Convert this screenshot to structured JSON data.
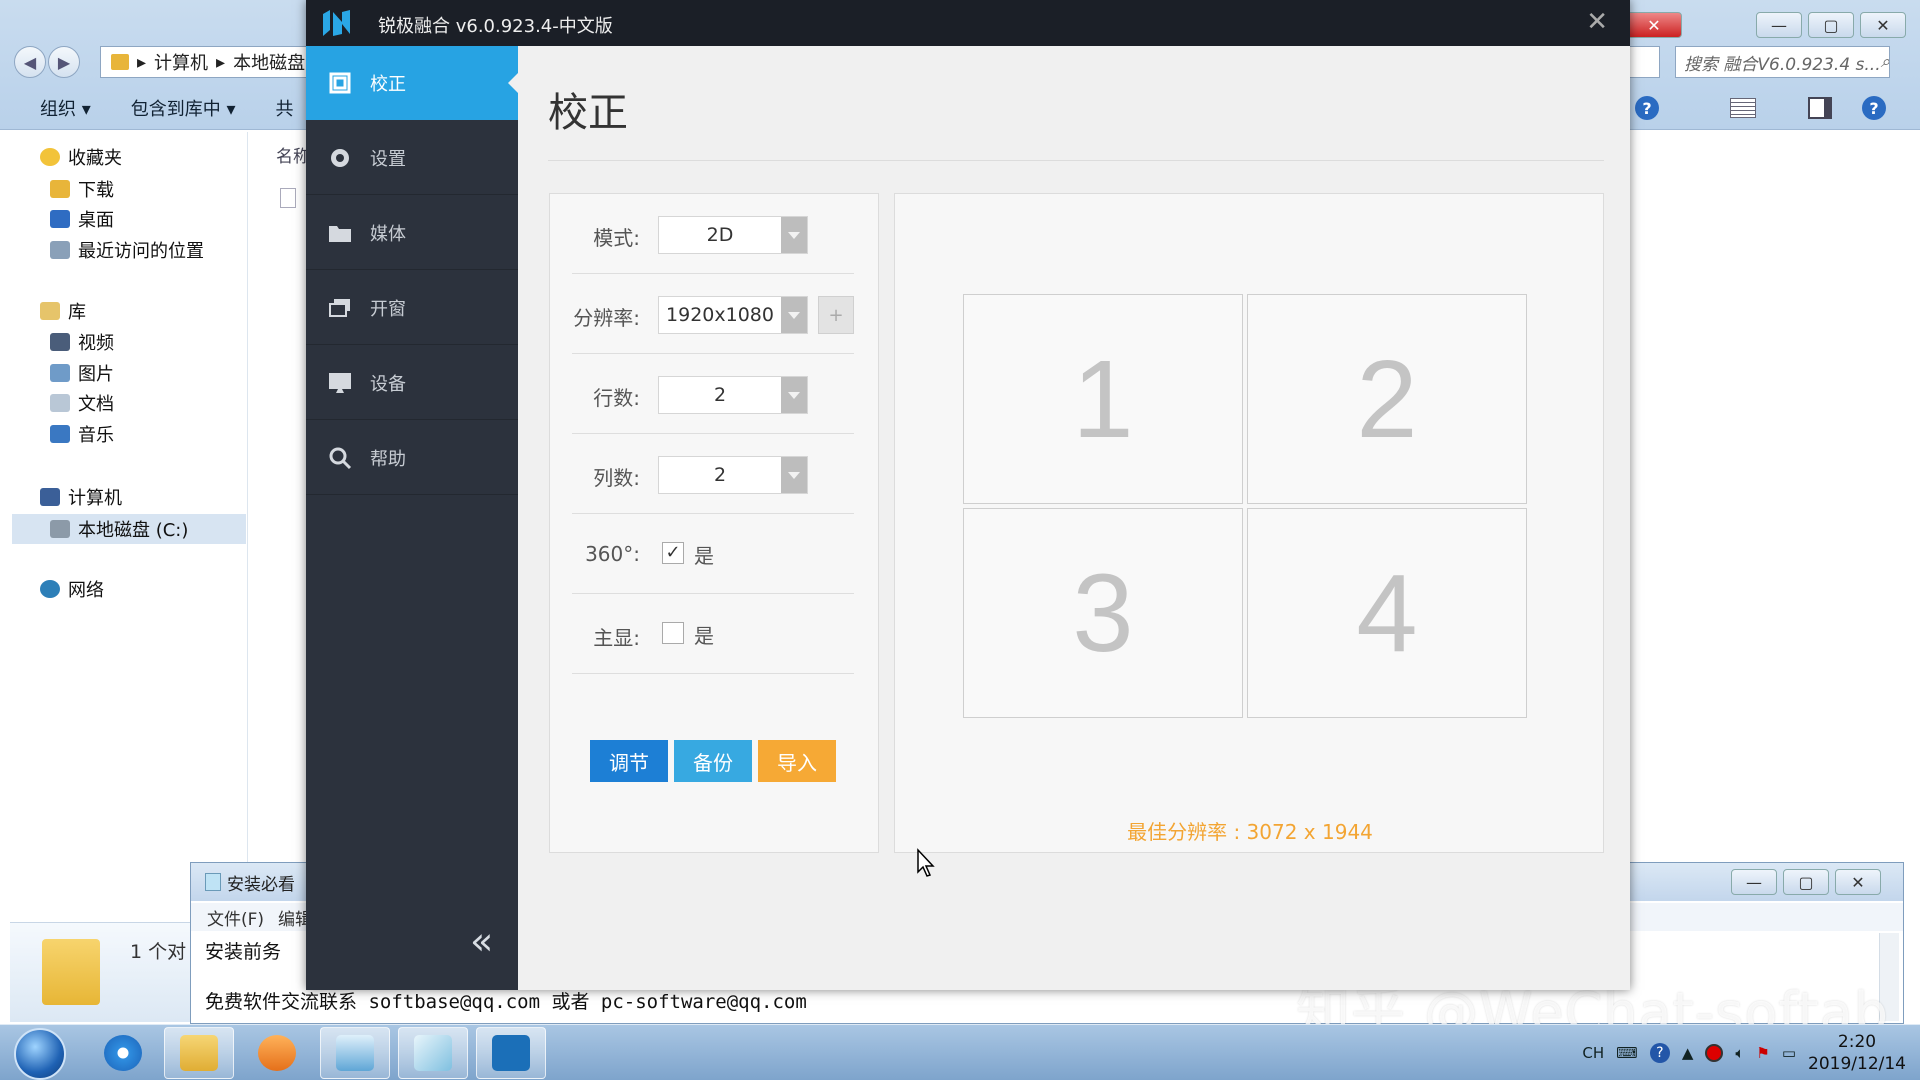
{
  "explorer": {
    "breadcrumb": [
      "计算机",
      "本地磁盘"
    ],
    "search_placeholder": "搜索 融合V6.0.923.4 s...",
    "toolbar": [
      "组织 ▾",
      "包含到库中 ▾",
      "共"
    ],
    "column_header": "名称",
    "nav": {
      "favorites": "收藏夹",
      "downloads": "下载",
      "desktop": "桌面",
      "recent": "最近访问的位置",
      "libraries": "库",
      "videos": "视频",
      "pictures": "图片",
      "documents": "文档",
      "music": "音乐",
      "computer": "计算机",
      "local_disk": "本地磁盘 (C:)",
      "network": "网络"
    },
    "status_count": "1 个对"
  },
  "notepad": {
    "title": "安装必看",
    "menu": [
      "文件(F)",
      "编辑"
    ],
    "line1": "安装前务",
    "line2": "免费软件交流联系 softbase@qq.com 或者 pc-software@qq.com"
  },
  "watermark": "知乎 @WeChat-softab",
  "app": {
    "title": "锐极融合 v6.0.923.4-中文版",
    "sidebar": [
      {
        "label": "校正",
        "icon": "calibrate-icon"
      },
      {
        "label": "设置",
        "icon": "gear-icon"
      },
      {
        "label": "媒体",
        "icon": "folder-icon"
      },
      {
        "label": "开窗",
        "icon": "windows-icon"
      },
      {
        "label": "设备",
        "icon": "monitor-icon"
      },
      {
        "label": "帮助",
        "icon": "search-icon"
      }
    ],
    "page_title": "校正",
    "form": {
      "mode_label": "模式:",
      "mode_value": "2D",
      "resolution_label": "分辨率:",
      "resolution_value": "1920x1080",
      "plus": "+",
      "rows_label": "行数:",
      "rows_value": "2",
      "cols_label": "列数:",
      "cols_value": "2",
      "r360_label": "360°:",
      "r360_checked": true,
      "r360_option": "是",
      "primary_label": "主显:",
      "primary_checked": false,
      "primary_option": "是"
    },
    "buttons": {
      "adjust": "调节",
      "backup": "备份",
      "import": "导入"
    },
    "grid_cells": [
      "1",
      "2",
      "3",
      "4"
    ],
    "best_resolution": "最佳分辨率 : 3072 x 1944",
    "colors": {
      "accent": "#27a3e3",
      "adjust_btn": "#1d7fd5",
      "backup_btn": "#37a9e1",
      "import_btn": "#f6a935",
      "best_res": "#f3a533"
    }
  },
  "taskbar": {
    "lang": "CH",
    "time": "2:20",
    "date": "2019/12/14"
  }
}
